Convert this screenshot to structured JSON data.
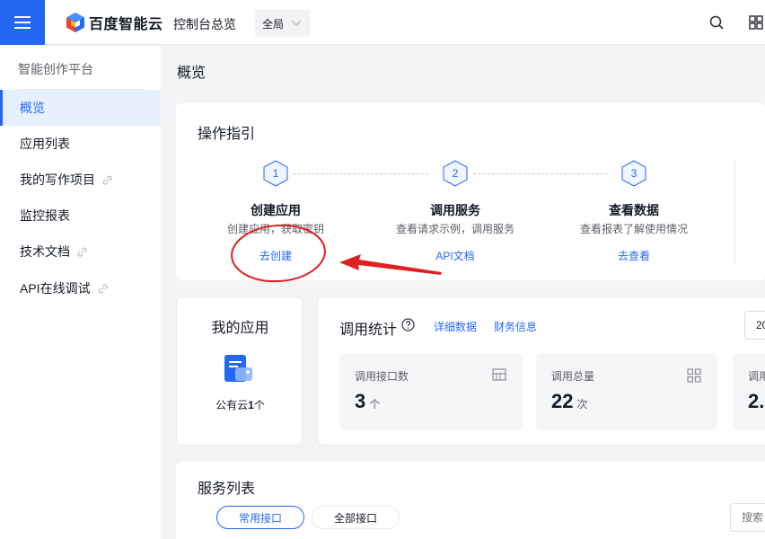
{
  "header": {
    "logo_text": "百度智能云",
    "nav_overview": "控制台总览",
    "region": "全局"
  },
  "sidebar": {
    "title": "智能创作平台",
    "items": [
      {
        "label": "概览",
        "active": true,
        "link": false
      },
      {
        "label": "应用列表",
        "active": false,
        "link": false
      },
      {
        "label": "我的写作项目",
        "active": false,
        "link": true
      },
      {
        "label": "监控报表",
        "active": false,
        "link": false
      },
      {
        "label": "技术文档",
        "active": false,
        "link": true
      },
      {
        "label": "API在线调试",
        "active": false,
        "link": true
      }
    ]
  },
  "main": {
    "page_title": "概览",
    "guide": {
      "title": "操作指引",
      "steps": [
        {
          "num": "1",
          "name": "创建应用",
          "desc": "创建应用，获取密钥",
          "link": "去创建"
        },
        {
          "num": "2",
          "name": "调用服务",
          "desc": "查看请求示例，调用服务",
          "link": "API文档"
        },
        {
          "num": "3",
          "name": "查看数据",
          "desc": "查看报表了解使用情况",
          "link": "去查看"
        }
      ]
    },
    "my_app": {
      "title": "我的应用",
      "count_prefix": "公有云",
      "count": "1",
      "count_suffix": "个"
    },
    "stats": {
      "title": "调用统计",
      "link_detail": "详细数据",
      "link_finance": "财务信息",
      "date": "20",
      "boxes": [
        {
          "label": "调用接口数",
          "value": "3",
          "unit": "个",
          "icon": "table-icon"
        },
        {
          "label": "调用总量",
          "value": "22",
          "unit": "次",
          "icon": "grid-icon"
        },
        {
          "label": "调用",
          "value": "2.",
          "unit": "",
          "icon": ""
        }
      ]
    },
    "services": {
      "title": "服务列表",
      "tab_common": "常用接口",
      "tab_all": "全部接口",
      "search_placeholder": "搜索"
    }
  },
  "colors": {
    "brand": "#2468f2",
    "annotation": "#e02020"
  }
}
